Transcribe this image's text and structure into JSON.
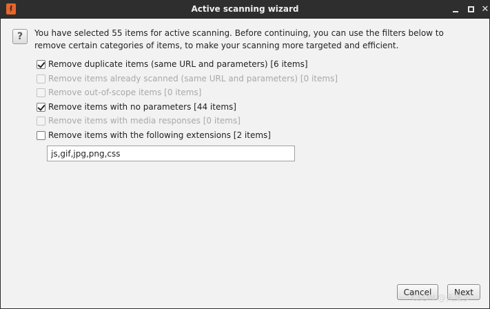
{
  "window": {
    "title": "Active scanning wizard"
  },
  "intro": {
    "text": "You have selected 55 items for active scanning. Before continuing, you can use the filters below to remove certain categories of items, to make your scanning more targeted and efficient."
  },
  "options": [
    {
      "label": "Remove duplicate items (same URL and parameters) [6 items]",
      "checked": true,
      "enabled": true
    },
    {
      "label": "Remove items already scanned (same URL and parameters) [0 items]",
      "checked": false,
      "enabled": false
    },
    {
      "label": "Remove out-of-scope items [0 items]",
      "checked": false,
      "enabled": false
    },
    {
      "label": "Remove items with no parameters [44 items]",
      "checked": true,
      "enabled": true
    },
    {
      "label": "Remove items with media responses [0 items]",
      "checked": false,
      "enabled": false
    },
    {
      "label": "Remove items with the following extensions [2 items]",
      "checked": false,
      "enabled": true
    }
  ],
  "extensions": {
    "value": "js,gif,jpg,png,css"
  },
  "buttons": {
    "cancel": "Cancel",
    "next": "Next"
  },
  "watermark": "CSDN @天策彡",
  "icons": {
    "help": "question-icon",
    "app": "burp-app-icon"
  }
}
